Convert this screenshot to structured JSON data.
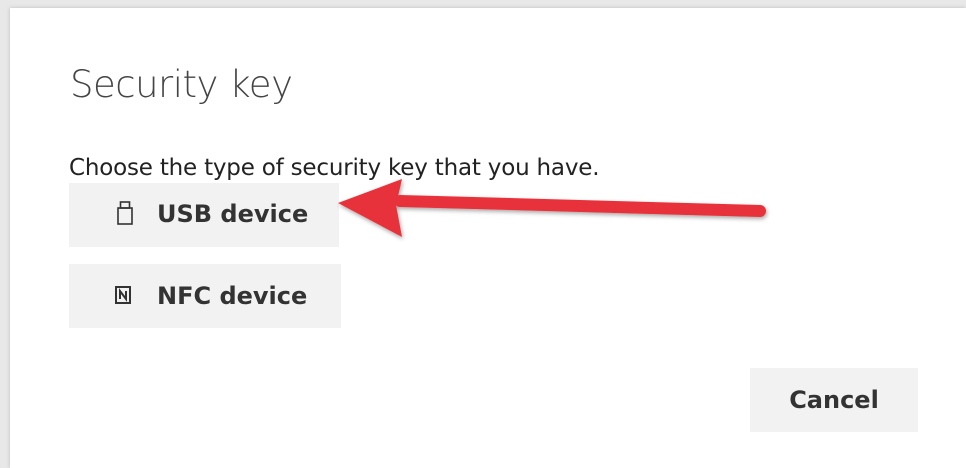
{
  "dialog": {
    "title": "Security key",
    "prompt": "Choose the type of security key that you have.",
    "options": [
      {
        "label": "USB device",
        "icon": "usb-icon"
      },
      {
        "label": "NFC device",
        "icon": "nfc-icon"
      }
    ],
    "cancel_label": "Cancel"
  },
  "annotation": {
    "arrow_color": "#e8333a",
    "points_to": "USB device"
  }
}
